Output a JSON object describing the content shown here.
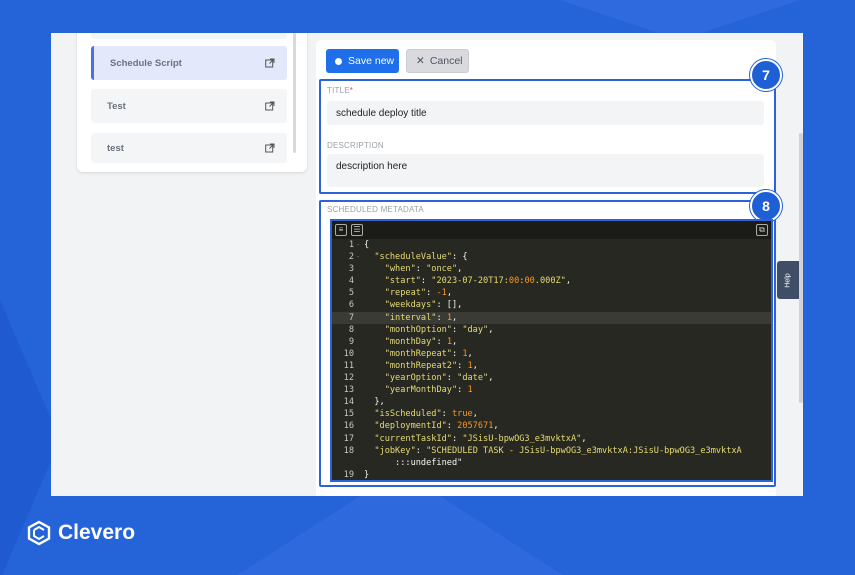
{
  "scripts": [
    {
      "label": ""
    },
    {
      "label": "Schedule Script",
      "active": true
    },
    {
      "label": "Test"
    },
    {
      "label": "test"
    }
  ],
  "toolbar": {
    "save_label": "Save new",
    "cancel_label": "Cancel"
  },
  "form": {
    "title_label": "TITLE",
    "title_required": "*",
    "title_value": "schedule deploy title",
    "description_label": "DESCRIPTION",
    "description_value": "description here",
    "metadata_label": "SCHEDULED METADATA"
  },
  "badges": {
    "step7": "7",
    "step8": "8"
  },
  "help_label": "Help",
  "brand": {
    "name": "Clevero"
  },
  "colors": {
    "accent": "#1f6feb",
    "highlight": "#2c63d6",
    "background": "#2563d9",
    "editor_bg": "#272822"
  },
  "editor_lines": [
    {
      "n": "1",
      "fold": "-",
      "t": "{"
    },
    {
      "n": "2",
      "fold": "-",
      "t": "  \"scheduleValue\": {"
    },
    {
      "n": "3",
      "t": "    \"when\": \"once\","
    },
    {
      "n": "4",
      "t": "    \"start\": \"2023-07-20T17:00:00.000Z\","
    },
    {
      "n": "5",
      "t": "    \"repeat\": -1,"
    },
    {
      "n": "6",
      "t": "    \"weekdays\": [],"
    },
    {
      "n": "7",
      "t": "    \"interval\": 1,",
      "current": true
    },
    {
      "n": "8",
      "t": "    \"monthOption\": \"day\","
    },
    {
      "n": "9",
      "t": "    \"monthDay\": 1,"
    },
    {
      "n": "10",
      "t": "    \"monthRepeat\": 1,"
    },
    {
      "n": "11",
      "t": "    \"monthRepeat2\": 1,"
    },
    {
      "n": "12",
      "t": "    \"yearOption\": \"date\","
    },
    {
      "n": "13",
      "t": "    \"yearMonthDay\": 1"
    },
    {
      "n": "14",
      "t": "  },"
    },
    {
      "n": "15",
      "t": "  \"isScheduled\": true,"
    },
    {
      "n": "16",
      "t": "  \"deploymentId\": 2057671,"
    },
    {
      "n": "17",
      "t": "  \"currentTaskId\": \"JSisU-bpwOG3_e3mvktxA\","
    },
    {
      "n": "18",
      "t": "  \"jobKey\": \"SCHEDULED TASK - JSisU-bpwOG3_e3mvktxA:JSisU-bpwOG3_e3mvktxA"
    },
    {
      "n": "",
      "t": "      :::undefined\""
    },
    {
      "n": "19",
      "t": "}"
    }
  ]
}
